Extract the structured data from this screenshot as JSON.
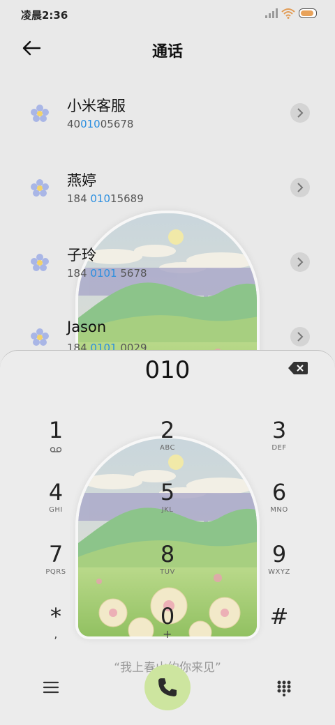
{
  "status_bar": {
    "time": "凌晨2:36"
  },
  "header": {
    "title": "通话"
  },
  "contacts": [
    {
      "name": "小米客服",
      "number_pre": "40",
      "number_hl": "010",
      "number_post": "05678"
    },
    {
      "name": "燕婷",
      "number_pre": "184 ",
      "number_hl": "010",
      "number_post": "15689"
    },
    {
      "name": "子玲",
      "number_pre": "184 ",
      "number_hl": "0101",
      "number_post": " 5678"
    },
    {
      "name": "Jason",
      "number_pre": "184 ",
      "number_hl": "0101",
      "number_post": " 0029"
    }
  ],
  "dialpad": {
    "input": "010",
    "keys": [
      {
        "digit": "1",
        "letters": ""
      },
      {
        "digit": "2",
        "letters": "ABC"
      },
      {
        "digit": "3",
        "letters": "DEF"
      },
      {
        "digit": "4",
        "letters": "GHI"
      },
      {
        "digit": "5",
        "letters": "JKL"
      },
      {
        "digit": "6",
        "letters": "MNO"
      },
      {
        "digit": "7",
        "letters": "PQRS"
      },
      {
        "digit": "8",
        "letters": "TUV"
      },
      {
        "digit": "9",
        "letters": "WXYZ"
      },
      {
        "digit": "*",
        "letters": ","
      },
      {
        "digit": "0",
        "letters": "+"
      },
      {
        "digit": "#",
        "letters": ""
      }
    ],
    "quote": "“我上春山约你来见”"
  },
  "colors": {
    "highlight": "#2a8ee0",
    "call_button": "#cde59f",
    "battery": "#e8a25a"
  }
}
